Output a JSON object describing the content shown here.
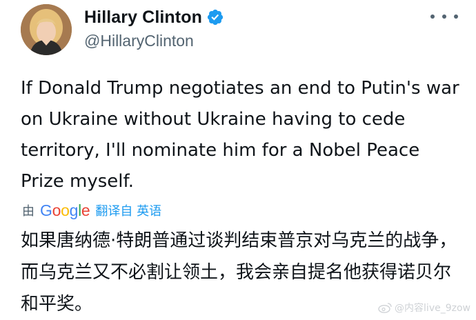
{
  "tweet": {
    "author": {
      "display_name": "Hillary Clinton",
      "handle": "@HillaryClinton",
      "verified": true,
      "avatar": "profile-photo"
    },
    "more_icon": "more-horizontal-icon",
    "text": "If Donald Trump negotiates an end to Putin's war on Ukraine without Ukraine having to cede territory, I'll nominate him for a Nobel Peace Prize myself.",
    "translation": {
      "by_label": "由",
      "provider": "Google",
      "provider_letters": [
        "G",
        "o",
        "o",
        "g",
        "l",
        "e"
      ],
      "link_label": "翻译自 英语",
      "text": "如果唐纳德·特朗普通过谈判结束普京对乌克兰的战争，而乌克兰又不必割让领土，我会亲自提名他获得诺贝尔和平奖。"
    }
  },
  "watermark": {
    "text": "@内容live_9zow"
  },
  "colors": {
    "text_primary": "#0f1419",
    "text_secondary": "#536471",
    "verified": "#1d9bf0",
    "link": "#1d9bf0"
  }
}
